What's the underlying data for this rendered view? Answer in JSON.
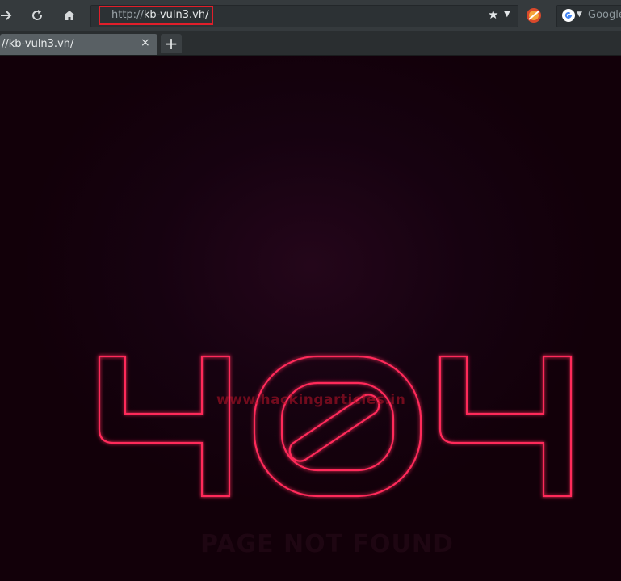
{
  "browser": {
    "url_scheme": "http://",
    "url_host": "kb-vuln3.vh/",
    "tab_title": "//kb-vuln3.vh/",
    "tab_close": "×",
    "new_tab": "+",
    "search_placeholder": "Google",
    "icons": {
      "forward": "forward-arrow-icon",
      "reload": "reload-icon",
      "home": "home-icon",
      "star": "bookmark-star-icon",
      "addon": "addon-icon",
      "search_engine": "google-icon"
    },
    "highlight_color": "#e01e2a"
  },
  "page": {
    "error_code": "404",
    "watermark": "www.hackingarticles.in",
    "caption": "PAGE NOT FOUND",
    "neon_color": "#ff2a5a"
  }
}
